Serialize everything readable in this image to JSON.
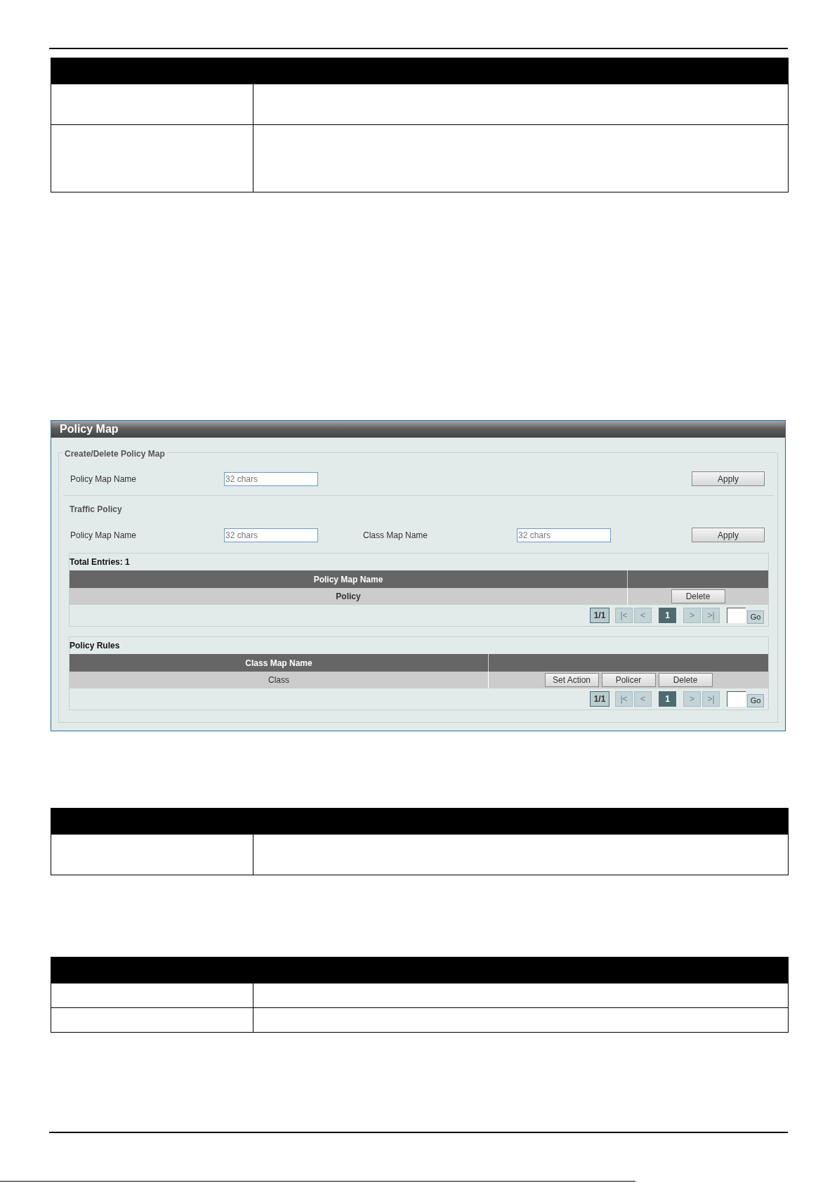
{
  "window": {
    "title": "Policy Map"
  },
  "create_delete": {
    "legend": "Create/Delete Policy Map",
    "fields": [
      {
        "label": "Policy Map Name",
        "placeholder": "32 chars"
      }
    ],
    "button": "Apply"
  },
  "traffic_policy": {
    "title": "Traffic Policy",
    "fields": [
      {
        "label": "Policy Map Name",
        "placeholder": "32 chars"
      },
      {
        "label": "Class Map Name",
        "placeholder": "32 chars"
      }
    ],
    "button": "Apply"
  },
  "entries": {
    "title": "Total Entries: 1",
    "columns": [
      "Policy Map Name"
    ],
    "rows": [
      {
        "name": "Policy",
        "buttons": [
          "Delete"
        ]
      }
    ],
    "pager": {
      "count": "1/1",
      "nav": [
        {
          "label": "|<",
          "disabled": true
        },
        {
          "label": "<",
          "disabled": true
        },
        {
          "label": "1",
          "selected": true
        },
        {
          "label": ">",
          "disabled": true
        },
        {
          "label": ">|",
          "disabled": true
        }
      ],
      "go": "Go"
    }
  },
  "policy_rules": {
    "title": "Policy Rules",
    "columns": [
      "Class Map Name"
    ],
    "rows": [
      {
        "name": "Class",
        "buttons": [
          "Set Action",
          "Policer",
          "Delete"
        ]
      }
    ],
    "pager": {
      "count": "1/1",
      "nav": [
        {
          "label": "|<",
          "disabled": true
        },
        {
          "label": "<",
          "disabled": true
        },
        {
          "label": "1",
          "selected": true
        },
        {
          "label": ">",
          "disabled": true
        },
        {
          "label": ">|",
          "disabled": true
        }
      ],
      "go": "Go"
    }
  }
}
